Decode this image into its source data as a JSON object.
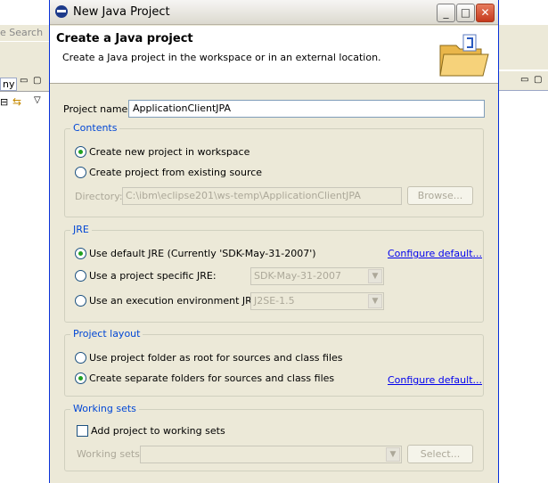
{
  "background": {
    "search_label": "e Search",
    "tab_label": "ny"
  },
  "window": {
    "title": "New Java Project",
    "controls": {
      "minimize": "_",
      "maximize": "□",
      "close": "✕"
    }
  },
  "header": {
    "title": "Create a Java project",
    "description": "Create a Java project in the workspace or in an external location."
  },
  "project_name": {
    "label": "Project name:",
    "value": "ApplicationClientJPA"
  },
  "contents": {
    "title": "Contents",
    "option_new": "Create new project in workspace",
    "option_existing": "Create project from existing source",
    "selected": "option_new",
    "directory_label": "Directory:",
    "directory_value": "C:\\ibm\\eclipse201\\ws-temp\\ApplicationClientJPA",
    "browse_label": "Browse..."
  },
  "jre": {
    "title": "JRE",
    "option_default": "Use default JRE (Currently 'SDK-May-31-2007')",
    "option_specific": "Use a project specific JRE:",
    "option_env": "Use an execution environment JRE:",
    "selected": "option_default",
    "configure_link": "Configure default...",
    "specific_combo_value": "SDK-May-31-2007",
    "env_combo_value": "J2SE-1.5"
  },
  "layout": {
    "title": "Project layout",
    "option_root": "Use project folder as root for sources and class files",
    "option_separate": "Create separate folders for sources and class files",
    "selected": "option_separate",
    "configure_link": "Configure default..."
  },
  "working_sets": {
    "title": "Working sets",
    "checkbox_label": "Add project to working sets",
    "checked": false,
    "sets_label": "Working sets:",
    "select_label": "Select..."
  },
  "colors": {
    "dialog_bg": "#ece9d8",
    "group_title": "#0046d5",
    "link": "#0000ee",
    "radio_selected": "#21a121"
  }
}
